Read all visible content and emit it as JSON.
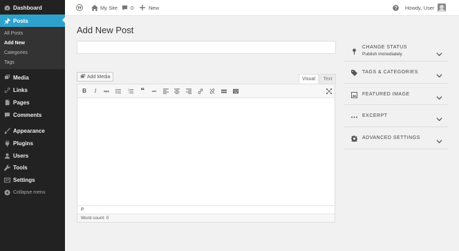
{
  "sidebar": {
    "items": [
      {
        "label": "Dashboard",
        "icon": "dashboard-icon"
      },
      {
        "label": "Posts",
        "icon": "pushpin-icon",
        "active": true
      },
      {
        "label": "Media",
        "icon": "media-icon"
      },
      {
        "label": "Links",
        "icon": "link-icon"
      },
      {
        "label": "Pages",
        "icon": "pages-icon"
      },
      {
        "label": "Comments",
        "icon": "comments-icon"
      },
      {
        "label": "Appearance",
        "icon": "brush-icon"
      },
      {
        "label": "Plugins",
        "icon": "plugins-icon"
      },
      {
        "label": "Users",
        "icon": "users-icon"
      },
      {
        "label": "Tools",
        "icon": "wrench-icon"
      },
      {
        "label": "Settings",
        "icon": "settings-icon"
      }
    ],
    "submenu": [
      "All Posts",
      "Add New",
      "Categories",
      "Tags"
    ],
    "collapse_label": "Collapse menu",
    "accent_color": "#2ea2cc"
  },
  "topbar": {
    "site_name": "My Site",
    "comments_count": "0",
    "new_label": "New",
    "greeting": "Howdy, User"
  },
  "main": {
    "page_title": "Add New Post",
    "title_value": "",
    "add_media_label": "Add Media",
    "tab_visual": "Visual",
    "tab_text": "Text",
    "path_label": "P",
    "word_count": "Word count: 0"
  },
  "panels": [
    {
      "title": "CHANGE STATUS",
      "subtitle": "Publish immediately",
      "icon": "pin-icon"
    },
    {
      "title": "TAGS & CATEGORIES",
      "icon": "tag-icon"
    },
    {
      "title": "FEATURED IMAGE",
      "icon": "image-icon"
    },
    {
      "title": "EXCERPT",
      "icon": "ellipsis-icon"
    },
    {
      "title": "ADVANCED SETTINGS",
      "icon": "gear-icon"
    }
  ]
}
